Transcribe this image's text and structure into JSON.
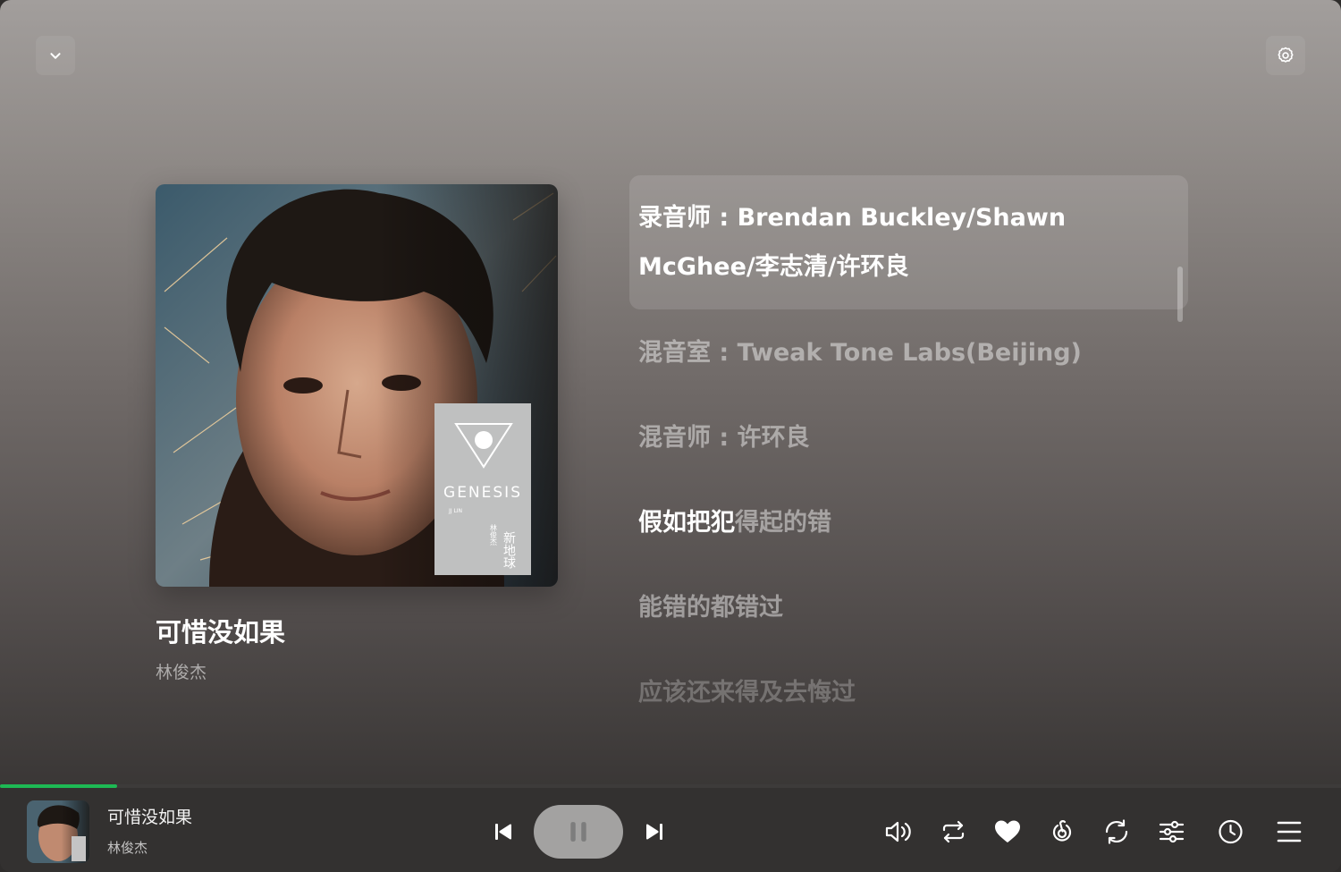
{
  "now_playing": {
    "title": "可惜没如果",
    "artist": "林俊杰",
    "progress_fraction": 0.087
  },
  "lyrics": [
    {
      "text": "录音师 : Brendan Buckley/Shawn McGhee/李志清/许环良",
      "state": "active"
    },
    {
      "text": "混音室 : Tweak Tone Labs(Beijing)",
      "state": "normal"
    },
    {
      "text": "混音师 : 许环良",
      "state": "normal"
    },
    {
      "sung": "假如把犯",
      "unsung": "得起的错",
      "state": "partial"
    },
    {
      "text": "能错的都错过",
      "state": "normal"
    },
    {
      "text": "应该还来得及去悔过",
      "state": "faded"
    }
  ],
  "album_art": {
    "label_text": "GENESIS",
    "label_sub": "JJ LIN",
    "label_cn": "新地球",
    "label_artist": "林俊杰"
  },
  "icons": {
    "collapse": "chevron-down-icon",
    "settings": "gear-icon",
    "previous": "skip-previous-icon",
    "pause": "pause-icon",
    "next": "skip-next-icon",
    "volume": "volume-icon",
    "repeat": "repeat-icon",
    "like": "heart-icon",
    "netease": "netease-icon",
    "shuffle": "loop-icon",
    "equalizer": "equalizer-icon",
    "timer": "clock-icon",
    "playlist": "menu-icon"
  },
  "colors": {
    "accent": "#1db954"
  }
}
